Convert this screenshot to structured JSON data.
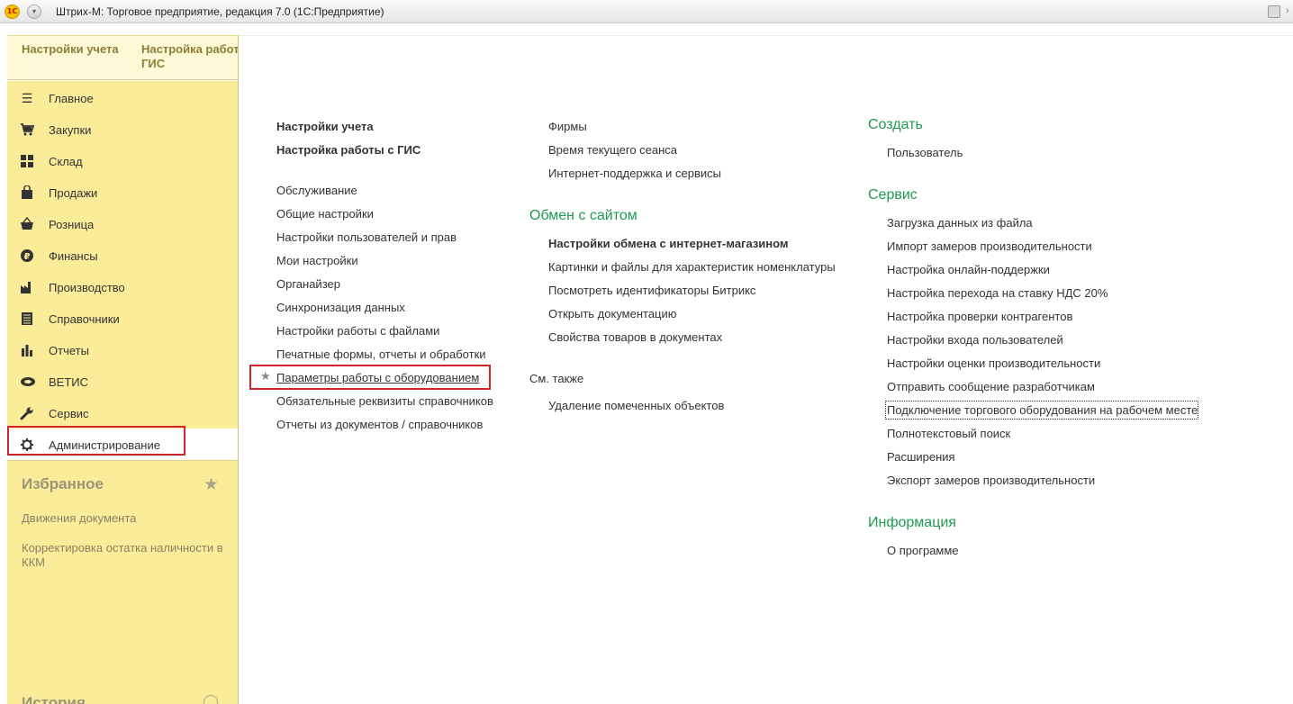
{
  "window": {
    "title": "Штрих-М: Торговое предприятие, редакция 7.0  (1С:Предприятие)",
    "logo_text": "1С"
  },
  "topbar": {
    "tabs": [
      "Настройки учета",
      "Настройка работы с ГИС"
    ]
  },
  "sidebar": {
    "items": [
      {
        "label": "Главное",
        "icon": "menu-lines-icon"
      },
      {
        "label": "Закупки",
        "icon": "cart-icon"
      },
      {
        "label": "Склад",
        "icon": "warehouse-grid-icon"
      },
      {
        "label": "Продажи",
        "icon": "shopping-bag-icon"
      },
      {
        "label": "Розница",
        "icon": "basket-icon"
      },
      {
        "label": "Финансы",
        "icon": "ruble-coin-icon"
      },
      {
        "label": "Производство",
        "icon": "factory-icon"
      },
      {
        "label": "Справочники",
        "icon": "book-list-icon"
      },
      {
        "label": "Отчеты",
        "icon": "bar-chart-icon"
      },
      {
        "label": "ВЕТИС",
        "icon": "vetis-icon"
      },
      {
        "label": "Сервис",
        "icon": "wrench-icon"
      },
      {
        "label": "Администрирование",
        "icon": "gear-icon"
      }
    ],
    "favorites_title": "Избранное",
    "favorites": [
      "Движения документа",
      "Корректировка остатка наличности в ККМ"
    ],
    "history_title": "История"
  },
  "main": {
    "col1": {
      "bold_links": [
        "Настройки учета",
        "Настройка работы с ГИС"
      ],
      "links": [
        "Обслуживание",
        "Общие настройки",
        "Настройки пользователей и прав",
        "Мои настройки",
        "Органайзер",
        "Синхронизация данных",
        "Настройки работы с файлами",
        "Печатные формы, отчеты и обработки",
        "Параметры работы с оборудованием",
        "Обязательные реквизиты справочников",
        "Отчеты из документов / справочников"
      ]
    },
    "col2": {
      "links_top": [
        "Фирмы",
        "Время текущего сеанса",
        "Интернет-поддержка и сервисы"
      ],
      "exchange_title": "Обмен с сайтом",
      "exchange_bold": "Настройки обмена с интернет-магазином",
      "exchange_links": [
        "Картинки и файлы для характеристик номенклатуры",
        "Посмотреть идентификаторы Битрикс",
        "Открыть документацию",
        "Свойства товаров в документах"
      ],
      "see_also_title": "См. также",
      "see_also_links": [
        "Удаление помеченных объектов"
      ]
    },
    "col3": {
      "create_title": "Создать",
      "create_links": [
        "Пользователь"
      ],
      "service_title": "Сервис",
      "service_links": [
        "Загрузка данных из файла",
        "Импорт замеров производительности",
        "Настройка онлайн-поддержки",
        "Настройка перехода на ставку НДС 20%",
        "Настройка проверки контрагентов",
        "Настройки входа пользователей",
        "Настройки оценки производительности",
        "Отправить сообщение разработчикам",
        "Подключение торгового оборудования на рабочем месте",
        "Полнотекстовый поиск",
        "Расширения",
        "Экспорт замеров производительности"
      ],
      "info_title": "Информация",
      "info_links": [
        "О программе"
      ]
    }
  },
  "colors": {
    "sidebar_bg": "#faec99",
    "group_title": "#1e9a4e",
    "highlight_frame": "#d0262b"
  }
}
